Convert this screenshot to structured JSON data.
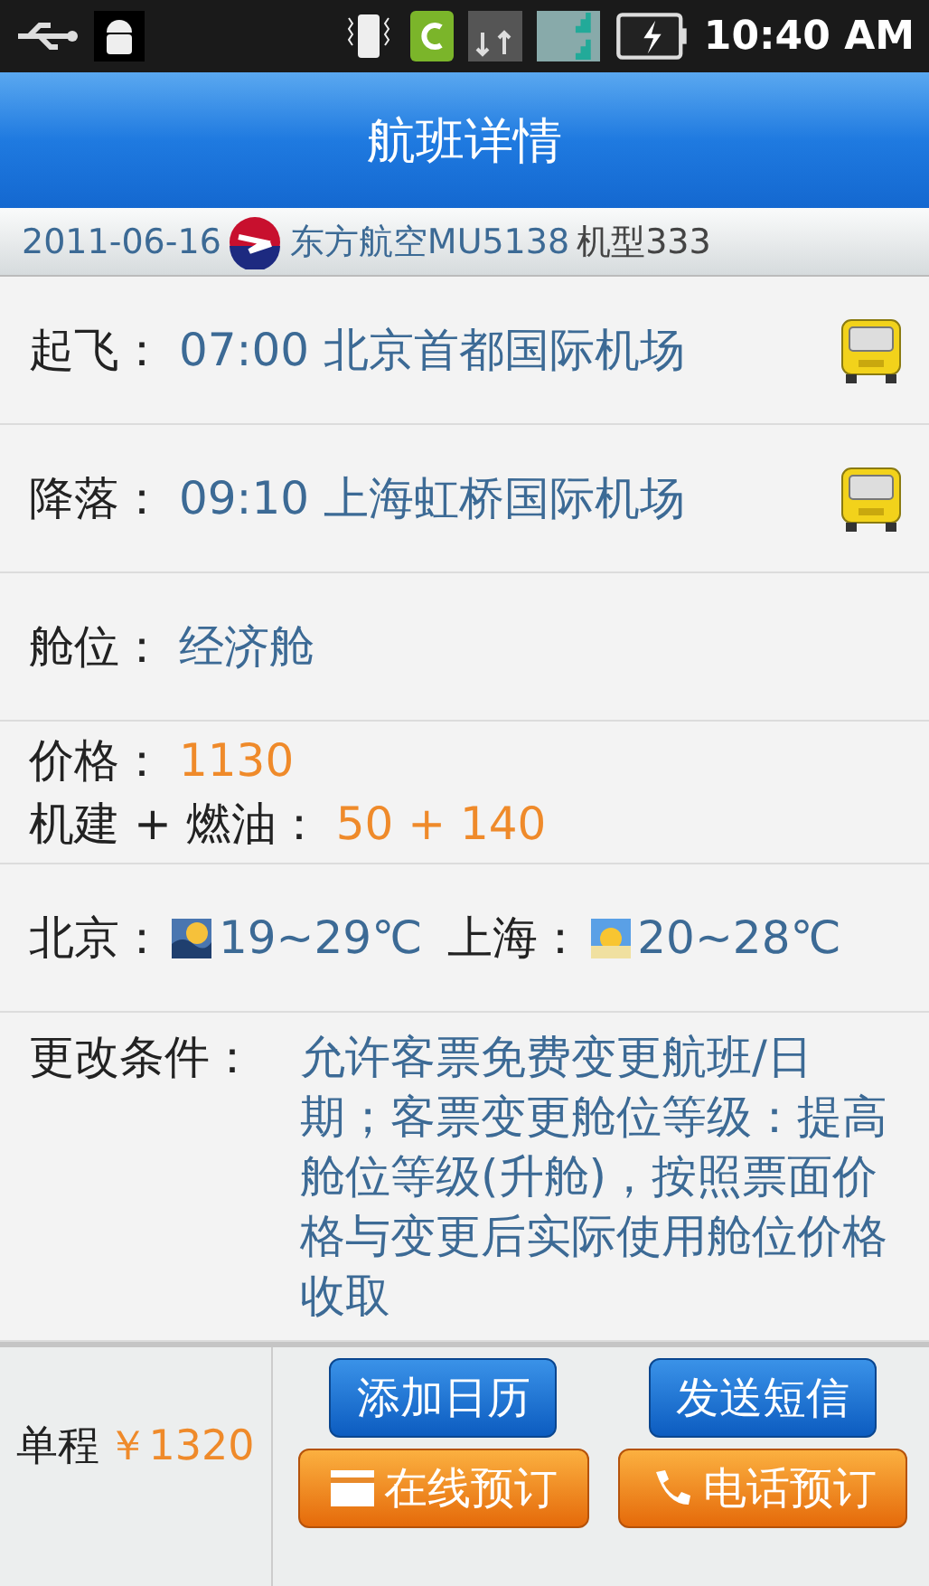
{
  "status_bar": {
    "time": "10:40 AM"
  },
  "header": {
    "title": "航班详情"
  },
  "flight_info": {
    "date": "2011-06-16",
    "airline": "东方航空MU5138",
    "aircraft": "机型333"
  },
  "rows": [
    {
      "kind": "airport",
      "label": "起飞：",
      "value": "07:00 北京首都国际机场"
    },
    {
      "kind": "airport",
      "label": "降落：",
      "value": "09:10 上海虹桥国际机场"
    },
    {
      "kind": "field",
      "label": "舱位：",
      "value": "经济舱"
    },
    {
      "kind": "price",
      "items": [
        {
          "label": "价格：",
          "value": "1130"
        },
        {
          "label": "机建 + 燃油：",
          "value": "50 + 140"
        }
      ]
    },
    {
      "kind": "weather",
      "cities": [
        {
          "label": "北京：",
          "temp": "19~29℃"
        },
        {
          "label": "上海：",
          "temp": "20~28℃"
        }
      ]
    },
    {
      "kind": "conditions",
      "label": "更改条件：",
      "value": "允许客票免费变更航班/日期；客票变更舱位等级：提高舱位等级(升舱)，按照票面价格与变更后实际使用舱位价格收取"
    }
  ],
  "footer": {
    "fare_label": "单程",
    "fare": "￥1320",
    "buttons": [
      {
        "label": "添加日历",
        "kind": "secondary"
      },
      {
        "label": "发送短信",
        "kind": "secondary"
      },
      {
        "label": "在线预订",
        "kind": "primary"
      },
      {
        "label": "电话预订",
        "kind": "primary"
      }
    ]
  }
}
